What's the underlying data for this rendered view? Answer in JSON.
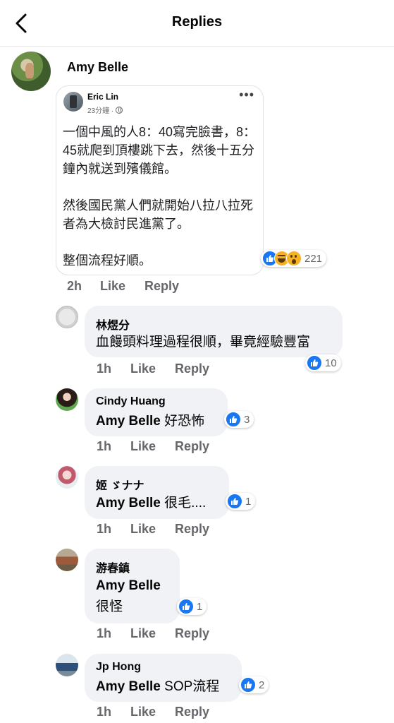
{
  "header": {
    "title": "Replies"
  },
  "main_comment": {
    "author": "Amy Belle",
    "shared_post": {
      "author": "Eric Lin",
      "time": "23分鐘 ·",
      "text": "一個中風的人8：40寫完臉書，8：45就爬到頂樓跳下去，然後十五分鐘內就送到殯儀館。\n\n然後國民黨人們就開始八拉八拉死者為大檢討民進黨了。\n\n整個流程好順。"
    },
    "reactions": [
      "like",
      "haha",
      "wow"
    ],
    "reaction_count": "221",
    "time": "2h",
    "like_label": "Like",
    "reply_label": "Reply"
  },
  "replies": [
    {
      "author": "林煜分",
      "mention": "",
      "text": "血饅頭料理過程很順，畢竟經驗豐富",
      "likes": "10",
      "time": "1h",
      "like_label": "Like",
      "reply_label": "Reply"
    },
    {
      "author": "Cindy Huang",
      "mention": "Amy Belle",
      "text": " 好恐怖",
      "likes": "3",
      "time": "1h",
      "like_label": "Like",
      "reply_label": "Reply"
    },
    {
      "author": "姬 ゞナナ",
      "mention": "Amy Belle",
      "text": " 很毛....",
      "likes": "1",
      "time": "1h",
      "like_label": "Like",
      "reply_label": "Reply"
    },
    {
      "author": "游春鎮",
      "mention": "Amy Belle",
      "text": "很怪",
      "likes": "1",
      "time": "1h",
      "like_label": "Like",
      "reply_label": "Reply"
    },
    {
      "author": "Jp Hong",
      "mention": "Amy Belle",
      "text": " SOP流程",
      "likes": "2",
      "time": "1h",
      "like_label": "Like",
      "reply_label": "Reply"
    }
  ],
  "colors": {
    "accent": "#1877f2",
    "bubble": "#f0f2f5",
    "secondary_text": "#65676b"
  }
}
